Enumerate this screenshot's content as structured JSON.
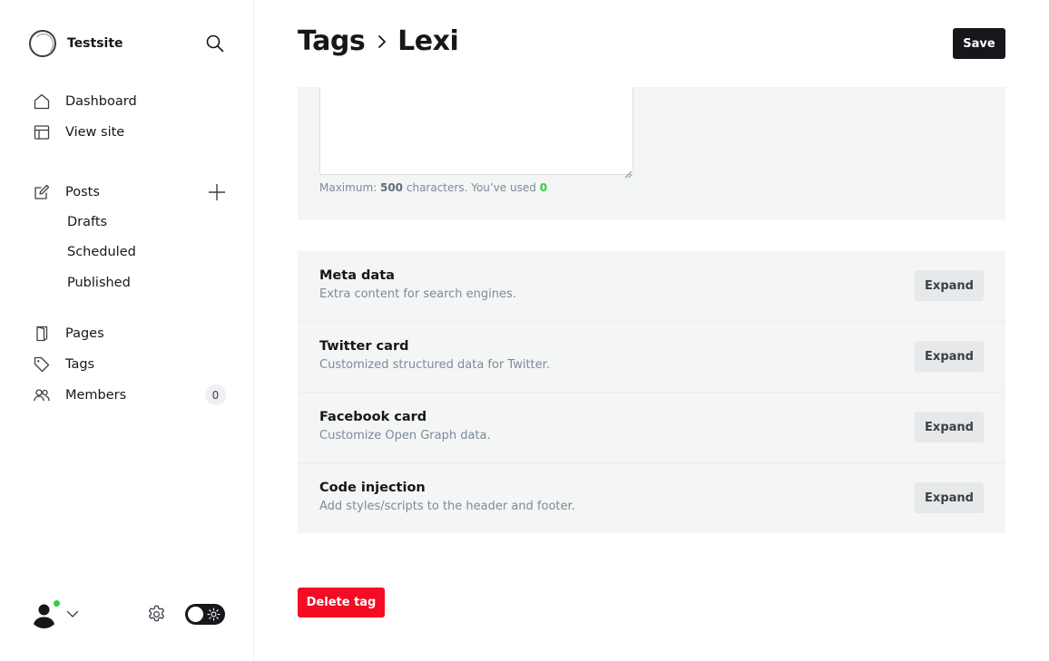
{
  "sidebar": {
    "site_name": "Testsite",
    "nav": {
      "dashboard": "Dashboard",
      "view_site": "View site",
      "posts": "Posts",
      "drafts": "Drafts",
      "scheduled": "Scheduled",
      "published": "Published",
      "pages": "Pages",
      "tags": "Tags",
      "members": "Members",
      "members_count": "0"
    },
    "icons": {
      "search": "search-icon",
      "dashboard": "home-icon",
      "view_site": "layout-icon",
      "posts": "edit-icon",
      "add_post": "plus-icon",
      "pages": "page-icon",
      "tags": "tag-icon",
      "members": "users-icon",
      "settings": "gear-icon",
      "theme": "sun-icon"
    },
    "status_color": "#30cf43"
  },
  "header": {
    "breadcrumb_parent": "Tags",
    "breadcrumb_current": "Lexi",
    "save_label": "Save"
  },
  "description": {
    "hint_prefix": "Maximum: ",
    "max_chars": "500",
    "hint_middle": " characters. You’ve used ",
    "used_chars": "0"
  },
  "settings_sections": [
    {
      "title": "Meta data",
      "desc": "Extra content for search engines.",
      "button": "Expand"
    },
    {
      "title": "Twitter card",
      "desc": "Customized structured data for Twitter.",
      "button": "Expand"
    },
    {
      "title": "Facebook card",
      "desc": "Customize Open Graph data.",
      "button": "Expand"
    },
    {
      "title": "Code injection",
      "desc": "Add styles/scripts to the header and footer.",
      "button": "Expand"
    }
  ],
  "delete_label": "Delete tag",
  "colors": {
    "accent_dark": "#15171a",
    "danger": "#f50b23",
    "success": "#30cf43",
    "panel_bg": "#f4f5f5"
  }
}
